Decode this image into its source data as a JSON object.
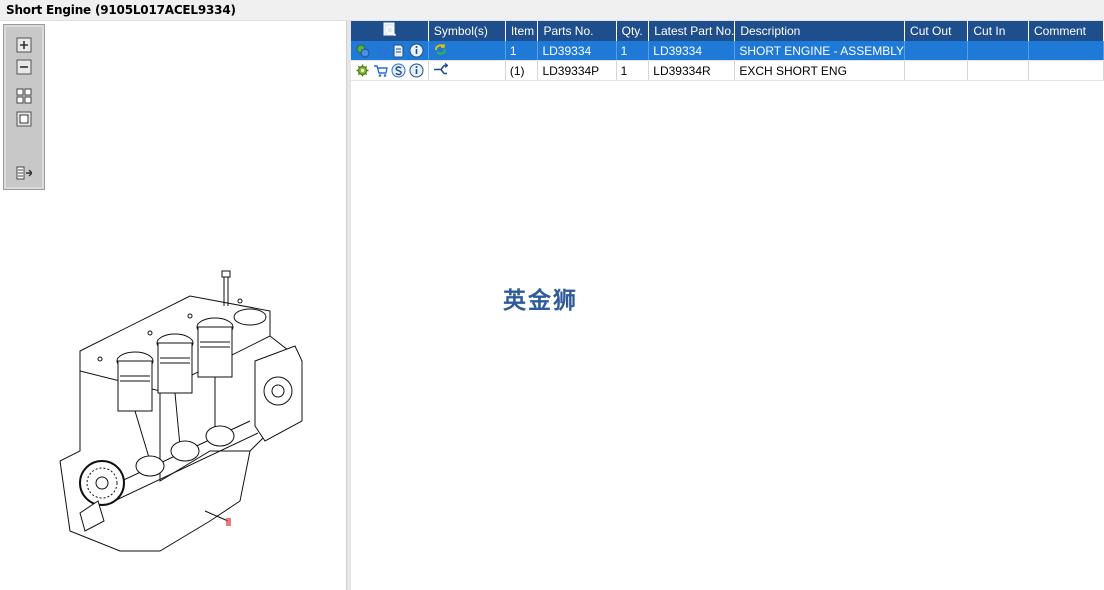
{
  "window": {
    "title": "Short Engine (9105L017ACEL9334)"
  },
  "toolbar": {
    "icons": [
      "zoom-in-icon",
      "zoom-out-icon",
      "fit-all-icon",
      "fit-page-icon",
      "list-export-icon"
    ]
  },
  "drawing": {
    "callout_label": "1",
    "callout_color": "#e05050"
  },
  "grid": {
    "columns": [
      "",
      "Symbol(s)",
      "Item",
      "Parts No.",
      "Qty.",
      "Latest Part No.",
      "Description",
      "Cut Out",
      "Cut In",
      "Comment"
    ],
    "rows": [
      {
        "selected": true,
        "icons": [
          "gear-link-icon",
          "cart-icon",
          "book-icon",
          "info-icon"
        ],
        "symbol_icon": "cycle-arrows-icon",
        "item": "1",
        "part_no": "LD39334",
        "qty": "1",
        "latest_part_no": "LD39334",
        "description": "SHORT ENGINE - ASSEMBLY",
        "cut_out": "",
        "cut_in": "",
        "comment": ""
      },
      {
        "selected": false,
        "icons": [
          "gear-icon",
          "cart-icon",
          "s-badge-icon",
          "info-icon"
        ],
        "symbol_icon": "exchange-arrow-icon",
        "item": "(1)",
        "part_no": "LD39334P",
        "qty": "1",
        "latest_part_no": "LD39334R",
        "description": "EXCH SHORT ENG",
        "cut_out": "",
        "cut_in": "",
        "comment": ""
      }
    ]
  },
  "watermark": {
    "text": "英金狮"
  },
  "colors": {
    "header_bg": "#1f4e8c",
    "selected_row_bg": "#1e7ad6"
  }
}
